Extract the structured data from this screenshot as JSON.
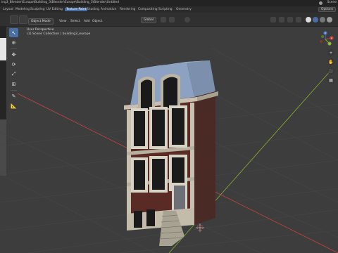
{
  "window": {
    "title": "ing3_Blender\\Europe\\Building_3\\Blender\\Europe\\Building_3\\Blender\\Untitled",
    "scene_label": "Scene"
  },
  "menu": {
    "items": [
      "Layout",
      "Modeling",
      "Sculpting",
      "UV Editing",
      "Texture Paint",
      "Shading",
      "Animation",
      "Rendering",
      "Compositing",
      "Scripting",
      "Geometry"
    ],
    "active_index": 4,
    "options_label": "Options"
  },
  "header": {
    "mode": "Object Mode",
    "menus": [
      "View",
      "Select",
      "Add",
      "Object"
    ],
    "orientation": "Global"
  },
  "viewport": {
    "perspective": "User Perspective",
    "collection": "(1) Scene Collection | building3_europe"
  },
  "tools": [
    "select-box",
    "cursor",
    "move",
    "rotate",
    "scale",
    "transform",
    "annotate",
    "measure"
  ],
  "icons": {
    "move": "✥",
    "rotate": "⟳",
    "scale": "⤢",
    "transform": "⊞",
    "annotate": "✎",
    "measure": "📐",
    "cursor": "⊕",
    "select": "↖"
  },
  "nav": {
    "gizmo_labels": [
      "X",
      "Y",
      "Z"
    ],
    "buttons": [
      "+",
      "✋",
      "🎥",
      "▦"
    ]
  },
  "colors": {
    "accent": "#4a6fa5",
    "axis_x": "#c8423f",
    "axis_y": "#86b02e",
    "axis_z": "#4a74c9",
    "brick": "#5a2b24",
    "roof": "#8da2c2",
    "trim": "#c8c1b1"
  }
}
